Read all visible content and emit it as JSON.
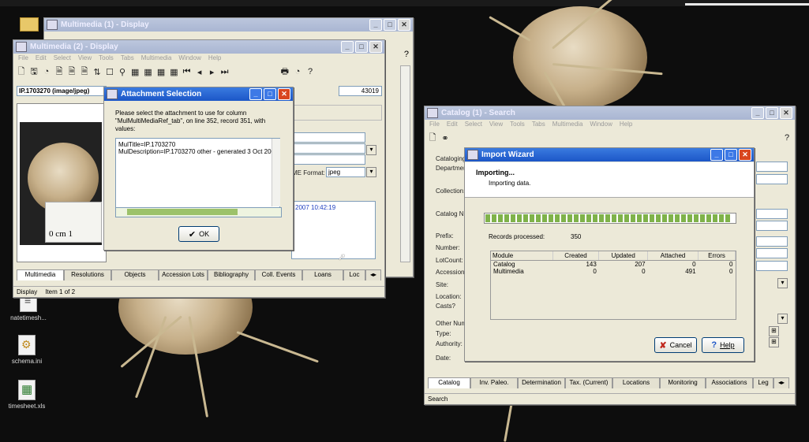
{
  "desktop": {
    "icons": [
      {
        "label": "natetimesh..."
      },
      {
        "label": "schema.ini"
      },
      {
        "label": "timesheet.xls"
      }
    ]
  },
  "mm1": {
    "title": "Multimedia (1) - Display"
  },
  "mm2": {
    "title": "Multimedia (2) - Display",
    "menu": [
      "File",
      "Edit",
      "Select",
      "View",
      "Tools",
      "Tabs",
      "Multimedia",
      "Window",
      "Help"
    ],
    "toolbar": [
      "🗋",
      "🖫",
      "◔",
      "🗎",
      "🗎",
      "🗎",
      "⇅",
      "☐",
      "⚲",
      "▦",
      "▦",
      "▦",
      "▦",
      "⏮",
      "◂",
      "▸",
      "⏭",
      "🖶",
      "◔",
      "?"
    ],
    "id_value": "IP.1703270 (image/jpeg)",
    "record_num": "43019",
    "mime_label": "ME Format:",
    "mime_value": "jpeg",
    "date_text": "2007 10:42:19",
    "scale_text": "0 cm 1",
    "tabs": [
      "Multimedia",
      "Resolutions",
      "Objects",
      "Accession Lots",
      "Bibliography",
      "Coll. Events",
      "Loans",
      "Loc"
    ],
    "status": [
      "Display",
      "Item 1 of 2"
    ]
  },
  "attach": {
    "title": "Attachment Selection",
    "message": "Please select the attachment to use for column \"MulMultiMediaRef_tab\", on line 352, record 351, with values:",
    "lines": [
      "MulTitle=IP.1703270",
      "MulDescription=IP.1703270 other - generated 3 Oct 200"
    ],
    "ok_label": "OK"
  },
  "catalog": {
    "title": "Catalog (1) - Search",
    "menu": [
      "File",
      "Edit",
      "Select",
      "View",
      "Tools",
      "Tabs",
      "Multimedia",
      "Window",
      "Help"
    ],
    "labels": [
      "Cataloging",
      "Departmer",
      "Collection:",
      "Catalog No",
      "Prefix:",
      "Number:",
      "LotCount:",
      "Accession",
      "Site:",
      "Location:",
      "Casts?",
      "Other Num",
      "Type:",
      "Authority:",
      "Date:"
    ],
    "tabs": [
      "Catalog",
      "Inv. Paleo.",
      "Determination",
      "Tax. (Current)",
      "Locations",
      "Monitoring",
      "Associations",
      "Leg"
    ],
    "status": "Search"
  },
  "wizard": {
    "title": "Import Wizard",
    "heading": "Importing...",
    "subheading": "Importing data.",
    "progress": 1.0,
    "processed_label": "Records processed:",
    "processed_value": "350",
    "columns": [
      "Module",
      "Created",
      "Updated",
      "Attached",
      "Errors"
    ],
    "rows": [
      [
        "Catalog",
        "143",
        "207",
        "0",
        "0"
      ],
      [
        "Multimedia",
        "0",
        "0",
        "491",
        "0"
      ]
    ],
    "cancel_label": "Cancel",
    "help_label": "Help"
  },
  "colors": {
    "progress": "#7fb24a",
    "titlebar_active": "#1c56c7"
  }
}
